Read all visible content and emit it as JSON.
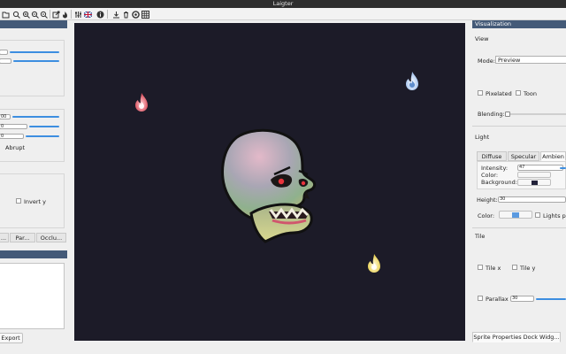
{
  "window": {
    "title": "Laigter"
  },
  "toolbar": {
    "icons": [
      "open-icon",
      "zoom-fit-icon",
      "zoom-in-icon",
      "zoom-out-icon",
      "zoom-reset-icon",
      "export-icon",
      "fire-icon",
      "sliders-icon",
      "flag-icon",
      "info-icon",
      "download-icon",
      "trash-icon",
      "target-icon",
      "grid-icon"
    ]
  },
  "left_panel": {
    "spin_values": [
      "",
      "",
      "00",
      "0",
      "0"
    ],
    "abrupt_label": "Abrupt",
    "invert_y_label": "Invert y",
    "tabs": [
      "...",
      "Par...",
      "Occlu..."
    ],
    "export_button": "Export"
  },
  "canvas": {
    "background": "#1c1b28",
    "lights": [
      {
        "name": "light-red",
        "color": "#e8606b"
      },
      {
        "name": "light-blue",
        "color": "#b9d2f3"
      },
      {
        "name": "light-yellow",
        "color": "#f3e070"
      }
    ]
  },
  "right_panel": {
    "dock_title": "Visualization",
    "view": {
      "section": "View",
      "mode_label": "Mode:",
      "mode_value": "Preview",
      "pixelated_label": "Pixelated",
      "toon_label": "Toon",
      "blending_label": "Blending:"
    },
    "light": {
      "section": "Light",
      "tabs": [
        "Diffuse",
        "Specular",
        "Ambien"
      ],
      "intensity_label": "Intensity:",
      "intensity_value": "47",
      "color_label": "Color:",
      "background_label": "Background:",
      "height_label": "Height:",
      "height_value": "30",
      "color2_label": "Color:",
      "lights_per_label": "Lights pe",
      "accent": "#3d8ee0",
      "background_swatch": "#23223a"
    },
    "tile": {
      "section": "Tile",
      "tile_x_label": "Tile x",
      "tile_y_label": "Tile y",
      "parallax_label": "Parallax",
      "parallax_value": "30"
    },
    "bottom_tab": "Sprite Properties Dock Widg..."
  }
}
